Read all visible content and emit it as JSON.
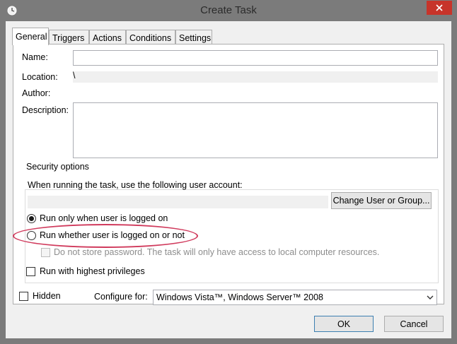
{
  "window": {
    "title": "Create Task",
    "icon": "task-scheduler-clock-icon",
    "close_icon": "close-icon"
  },
  "tabs": [
    {
      "label": "General",
      "active": true
    },
    {
      "label": "Triggers",
      "active": false
    },
    {
      "label": "Actions",
      "active": false
    },
    {
      "label": "Conditions",
      "active": false
    },
    {
      "label": "Settings",
      "active": false
    }
  ],
  "general": {
    "name_label": "Name:",
    "name_value": "",
    "location_label": "Location:",
    "location_value": "\\",
    "author_label": "Author:",
    "author_value": "",
    "description_label": "Description:",
    "description_value": ""
  },
  "security": {
    "group_title": "Security options",
    "account_prompt": "When running the task, use the following user account:",
    "account_value": "",
    "change_user_button": "Change User or Group...",
    "run_logged_on": "Run only when user is logged on",
    "run_logged_on_checked": true,
    "run_whether": "Run whether user is logged on or not",
    "run_whether_checked": false,
    "do_not_store": "Do not store password.  The task will only have access to local computer resources.",
    "do_not_store_checked": false,
    "highest_privileges": "Run with highest privileges",
    "highest_privileges_checked": false
  },
  "bottom": {
    "hidden_label": "Hidden",
    "hidden_checked": false,
    "configure_label": "Configure for:",
    "configure_value": "Windows Vista™, Windows Server™ 2008",
    "ok_button": "OK",
    "cancel_button": "Cancel"
  },
  "colors": {
    "highlight": "#d03a5c",
    "titlebar": "#7b7b7b",
    "close_button": "#c7342a"
  }
}
